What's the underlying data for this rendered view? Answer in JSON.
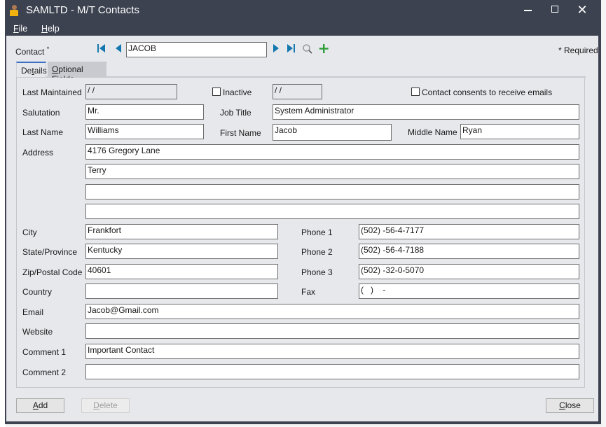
{
  "window": {
    "title": "SAMLTD - M/T Contacts",
    "controls": {
      "minimize": "minimize",
      "maximize": "maximize",
      "close": "✕"
    }
  },
  "menu": {
    "file": {
      "accel": "F",
      "rest": "ile"
    },
    "help": {
      "accel": "H",
      "rest": "elp"
    }
  },
  "header": {
    "contact_label": "Contact",
    "required_marker": "*",
    "contact_value": "JACOB",
    "required_note": "* Required"
  },
  "tabs": [
    {
      "label_pre": "De",
      "label_accel": "t",
      "label_post": "ails",
      "active": true
    },
    {
      "label_pre": "",
      "label_accel": "O",
      "label_post": "ptional Fields",
      "active": false
    }
  ],
  "details": {
    "last_maintained": {
      "label": "Last Maintained",
      "value": " /  /"
    },
    "inactive": {
      "label": "Inactive",
      "checked": false,
      "date": " /  /"
    },
    "consent": {
      "label": "Contact consents to receive emails",
      "checked": false
    },
    "salutation": {
      "label": "Salutation",
      "value": "Mr."
    },
    "job_title": {
      "label": "Job Title",
      "value": "System Administrator"
    },
    "last_name": {
      "label": "Last Name",
      "value": "Williams"
    },
    "first_name": {
      "label": "First Name",
      "value": "Jacob"
    },
    "middle_name": {
      "label": "Middle Name",
      "value": "Ryan"
    },
    "address": {
      "label": "Address",
      "lines": [
        "4176 Gregory Lane",
        "Terry",
        "",
        ""
      ]
    },
    "city": {
      "label": "City",
      "value": "Frankfort"
    },
    "state": {
      "label": "State/Province",
      "value": "Kentucky"
    },
    "zip": {
      "label": "Zip/Postal Code",
      "value": "40601"
    },
    "country": {
      "label": "Country",
      "value": ""
    },
    "phone1": {
      "label": "Phone 1",
      "value": "(502) -56-4-7177"
    },
    "phone2": {
      "label": "Phone 2",
      "value": "(502) -56-4-7188"
    },
    "phone3": {
      "label": "Phone 3",
      "value": "(502) -32-0-5070"
    },
    "fax": {
      "label": "Fax",
      "value": "(   )    -"
    },
    "email": {
      "label": "Email",
      "value": "Jacob@Gmail.com"
    },
    "website": {
      "label": "Website",
      "value": ""
    },
    "comment1": {
      "label": "Comment 1",
      "value": "Important Contact"
    },
    "comment2": {
      "label": "Comment 2",
      "value": ""
    }
  },
  "buttons": {
    "add": {
      "accel": "A",
      "rest": "dd",
      "enabled": true
    },
    "delete": {
      "accel": "D",
      "rest": "elete",
      "enabled": false
    },
    "close": {
      "accel": "C",
      "rest": "lose",
      "enabled": true
    }
  },
  "colors": {
    "title_bar": "#3d4250",
    "client_bg": "#e7e8ec",
    "nav_accent": "#1477ae",
    "new_icon": "#2e9e3a",
    "person_icon_body": "#f1b20f"
  }
}
